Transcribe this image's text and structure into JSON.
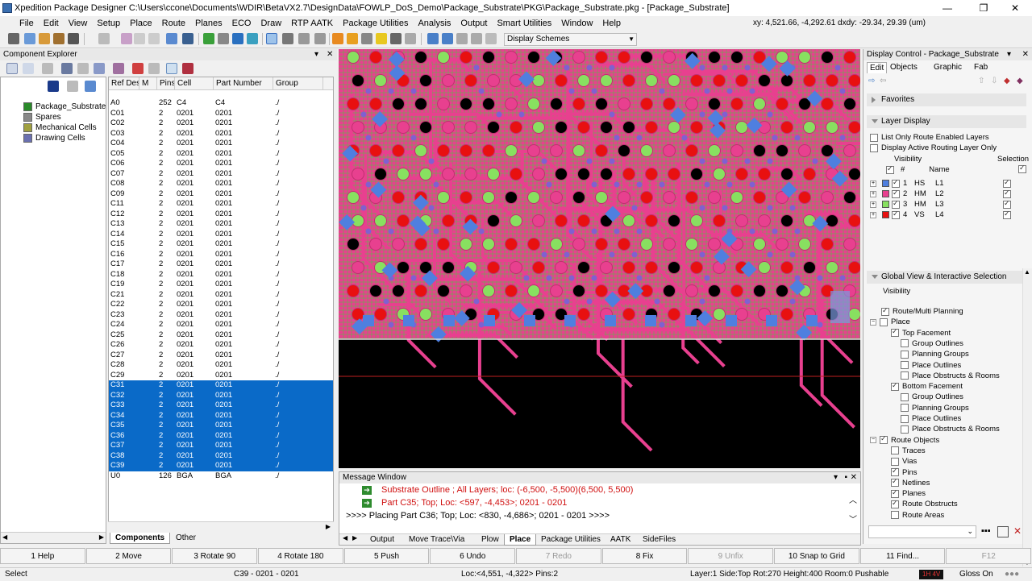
{
  "window": {
    "title": "Xpedition Package Designer  C:\\Users\\ccone\\Documents\\WDIR\\BetaVX2.7\\DesignData\\FOWLP_DoS_Demo\\Package_Substrate\\PKG\\Package_Substrate.pkg - [Package_Substrate]",
    "minimize": "—",
    "restore": "❐",
    "close": "✕"
  },
  "menubar": {
    "items": [
      "File",
      "Edit",
      "View",
      "Setup",
      "Place",
      "Route",
      "Planes",
      "ECO",
      "Draw",
      "RTP AATK",
      "Package Utilities",
      "Analysis",
      "Output",
      "Smart Utilities",
      "Window",
      "Help"
    ],
    "coords": "xy: 4,521.66, -4,292.61  dxdy: -29.34, 29.39 (um)"
  },
  "toolbar": {
    "display_schemes": "Display Schemes"
  },
  "component_explorer": {
    "title": "Component Explorer",
    "tree": [
      "Package_Substrate",
      "Spares",
      "Mechanical Cells",
      "Drawing Cells"
    ],
    "columns": [
      "Ref Des",
      "M",
      "Pins",
      "Cell",
      "Part Number",
      "Group"
    ],
    "rows": [
      {
        "ref": "A0",
        "m": "",
        "pins": "252",
        "cell": "C4",
        "part": "C4",
        "group": "./",
        "sel": false
      },
      {
        "ref": "C01",
        "m": "",
        "pins": "2",
        "cell": "0201",
        "part": "0201",
        "group": "./",
        "sel": false
      },
      {
        "ref": "C02",
        "m": "",
        "pins": "2",
        "cell": "0201",
        "part": "0201",
        "group": "./",
        "sel": false
      },
      {
        "ref": "C03",
        "m": "",
        "pins": "2",
        "cell": "0201",
        "part": "0201",
        "group": "./",
        "sel": false
      },
      {
        "ref": "C04",
        "m": "",
        "pins": "2",
        "cell": "0201",
        "part": "0201",
        "group": "./",
        "sel": false
      },
      {
        "ref": "C05",
        "m": "",
        "pins": "2",
        "cell": "0201",
        "part": "0201",
        "group": "./",
        "sel": false
      },
      {
        "ref": "C06",
        "m": "",
        "pins": "2",
        "cell": "0201",
        "part": "0201",
        "group": "./",
        "sel": false
      },
      {
        "ref": "C07",
        "m": "",
        "pins": "2",
        "cell": "0201",
        "part": "0201",
        "group": "./",
        "sel": false
      },
      {
        "ref": "C08",
        "m": "",
        "pins": "2",
        "cell": "0201",
        "part": "0201",
        "group": "./",
        "sel": false
      },
      {
        "ref": "C09",
        "m": "",
        "pins": "2",
        "cell": "0201",
        "part": "0201",
        "group": "./",
        "sel": false
      },
      {
        "ref": "C11",
        "m": "",
        "pins": "2",
        "cell": "0201",
        "part": "0201",
        "group": "./",
        "sel": false
      },
      {
        "ref": "C12",
        "m": "",
        "pins": "2",
        "cell": "0201",
        "part": "0201",
        "group": "./",
        "sel": false
      },
      {
        "ref": "C13",
        "m": "",
        "pins": "2",
        "cell": "0201",
        "part": "0201",
        "group": "./",
        "sel": false
      },
      {
        "ref": "C14",
        "m": "",
        "pins": "2",
        "cell": "0201",
        "part": "0201",
        "group": "./",
        "sel": false
      },
      {
        "ref": "C15",
        "m": "",
        "pins": "2",
        "cell": "0201",
        "part": "0201",
        "group": "./",
        "sel": false
      },
      {
        "ref": "C16",
        "m": "",
        "pins": "2",
        "cell": "0201",
        "part": "0201",
        "group": "./",
        "sel": false
      },
      {
        "ref": "C17",
        "m": "",
        "pins": "2",
        "cell": "0201",
        "part": "0201",
        "group": "./",
        "sel": false
      },
      {
        "ref": "C18",
        "m": "",
        "pins": "2",
        "cell": "0201",
        "part": "0201",
        "group": "./",
        "sel": false
      },
      {
        "ref": "C19",
        "m": "",
        "pins": "2",
        "cell": "0201",
        "part": "0201",
        "group": "./",
        "sel": false
      },
      {
        "ref": "C21",
        "m": "",
        "pins": "2",
        "cell": "0201",
        "part": "0201",
        "group": "./",
        "sel": false
      },
      {
        "ref": "C22",
        "m": "",
        "pins": "2",
        "cell": "0201",
        "part": "0201",
        "group": "./",
        "sel": false
      },
      {
        "ref": "C23",
        "m": "",
        "pins": "2",
        "cell": "0201",
        "part": "0201",
        "group": "./",
        "sel": false
      },
      {
        "ref": "C24",
        "m": "",
        "pins": "2",
        "cell": "0201",
        "part": "0201",
        "group": "./",
        "sel": false
      },
      {
        "ref": "C25",
        "m": "",
        "pins": "2",
        "cell": "0201",
        "part": "0201",
        "group": "./",
        "sel": false
      },
      {
        "ref": "C26",
        "m": "",
        "pins": "2",
        "cell": "0201",
        "part": "0201",
        "group": "./",
        "sel": false
      },
      {
        "ref": "C27",
        "m": "",
        "pins": "2",
        "cell": "0201",
        "part": "0201",
        "group": "./",
        "sel": false
      },
      {
        "ref": "C28",
        "m": "",
        "pins": "2",
        "cell": "0201",
        "part": "0201",
        "group": "./",
        "sel": false
      },
      {
        "ref": "C29",
        "m": "",
        "pins": "2",
        "cell": "0201",
        "part": "0201",
        "group": "./",
        "sel": false
      },
      {
        "ref": "C31",
        "m": "",
        "pins": "2",
        "cell": "0201",
        "part": "0201",
        "group": "./",
        "sel": true
      },
      {
        "ref": "C32",
        "m": "",
        "pins": "2",
        "cell": "0201",
        "part": "0201",
        "group": "./",
        "sel": true
      },
      {
        "ref": "C33",
        "m": "",
        "pins": "2",
        "cell": "0201",
        "part": "0201",
        "group": "./",
        "sel": true
      },
      {
        "ref": "C34",
        "m": "",
        "pins": "2",
        "cell": "0201",
        "part": "0201",
        "group": "./",
        "sel": true
      },
      {
        "ref": "C35",
        "m": "",
        "pins": "2",
        "cell": "0201",
        "part": "0201",
        "group": "./",
        "sel": true
      },
      {
        "ref": "C36",
        "m": "",
        "pins": "2",
        "cell": "0201",
        "part": "0201",
        "group": "./",
        "sel": true
      },
      {
        "ref": "C37",
        "m": "",
        "pins": "2",
        "cell": "0201",
        "part": "0201",
        "group": "./",
        "sel": true
      },
      {
        "ref": "C38",
        "m": "",
        "pins": "2",
        "cell": "0201",
        "part": "0201",
        "group": "./",
        "sel": true
      },
      {
        "ref": "C39",
        "m": "",
        "pins": "2",
        "cell": "0201",
        "part": "0201",
        "group": "./",
        "sel": true
      },
      {
        "ref": "U0",
        "m": "",
        "pins": "126",
        "cell": "BGA",
        "part": "BGA",
        "group": "./",
        "sel": false
      }
    ],
    "tabs": [
      "Components",
      "Other"
    ]
  },
  "message_window": {
    "title": "Message Window",
    "lines": [
      {
        "text": "Substrate Outline ; All Layers; loc: (-6,500, -5,500)(6,500, 5,500)",
        "color": "red"
      },
      {
        "text": "Part C35; Top; Loc: <597, -4,453>; 0201 - 0201",
        "color": "red"
      },
      {
        "text": ">>>> Placing Part C36; Top; Loc: <830, -4,686>; 0201 - 0201 >>>>",
        "color": "black"
      }
    ],
    "tabs": [
      "Output",
      "Move Trace\\Via",
      "Plow",
      "Place",
      "Package Utilities",
      "AATK",
      "SideFiles"
    ]
  },
  "display_control": {
    "title": "Display Control - Package_Substrate",
    "tabs": [
      "Edit",
      "Objects",
      "Graphic",
      "Fab"
    ],
    "favorites": "Favorites",
    "layer_display": "Layer Display",
    "opt1": "List Only Route Enabled Layers",
    "opt2": "Display Active Routing Layer Only",
    "visibility": "Visibility",
    "selection": "Selection",
    "hash": "#",
    "name_col": "Name",
    "layers": [
      {
        "num": "1",
        "type": "HS",
        "name": "L1",
        "color": "#4f7fdf"
      },
      {
        "num": "2",
        "type": "HM",
        "name": "L2",
        "color": "#e8408f"
      },
      {
        "num": "3",
        "type": "HM",
        "name": "L3",
        "color": "#88e060"
      },
      {
        "num": "4",
        "type": "VS",
        "name": "L4",
        "color": "#e81010"
      }
    ],
    "global_view": "Global View & Interactive Selection",
    "gv_visibility": "Visibility",
    "items": [
      {
        "label": "Route/Multi Planning",
        "indent": 0,
        "checked": true,
        "plus": false
      },
      {
        "label": "Place",
        "indent": 0,
        "checked": false,
        "plus": true
      },
      {
        "label": "Top Facement",
        "indent": 1,
        "checked": true,
        "plus": false
      },
      {
        "label": "Group Outlines",
        "indent": 2,
        "checked": false,
        "plus": false
      },
      {
        "label": "Planning Groups",
        "indent": 2,
        "checked": false,
        "plus": false
      },
      {
        "label": "Place Outlines",
        "indent": 2,
        "checked": false,
        "plus": false
      },
      {
        "label": "Place Obstructs & Rooms",
        "indent": 2,
        "checked": false,
        "plus": false
      },
      {
        "label": "Bottom Facement",
        "indent": 1,
        "checked": true,
        "plus": false
      },
      {
        "label": "Group Outlines",
        "indent": 2,
        "checked": false,
        "plus": false
      },
      {
        "label": "Planning Groups",
        "indent": 2,
        "checked": false,
        "plus": false
      },
      {
        "label": "Place Outlines",
        "indent": 2,
        "checked": false,
        "plus": false
      },
      {
        "label": "Place Obstructs & Rooms",
        "indent": 2,
        "checked": false,
        "plus": false
      },
      {
        "label": "Route Objects",
        "indent": 0,
        "checked": true,
        "plus": true
      },
      {
        "label": "Traces",
        "indent": 1,
        "checked": false,
        "plus": false
      },
      {
        "label": "Vias",
        "indent": 1,
        "checked": false,
        "plus": false
      },
      {
        "label": "Pins",
        "indent": 1,
        "checked": true,
        "plus": false
      },
      {
        "label": "Netlines",
        "indent": 1,
        "checked": true,
        "plus": false
      },
      {
        "label": "Planes",
        "indent": 1,
        "checked": true,
        "plus": false
      },
      {
        "label": "Route Obstructs",
        "indent": 1,
        "checked": true,
        "plus": false
      },
      {
        "label": "Route Areas",
        "indent": 1,
        "checked": false,
        "plus": false
      }
    ]
  },
  "function_keys": [
    {
      "label": "1 Help",
      "enabled": true
    },
    {
      "label": "2 Move",
      "enabled": true
    },
    {
      "label": "3 Rotate 90",
      "enabled": true
    },
    {
      "label": "4 Rotate 180",
      "enabled": true
    },
    {
      "label": "5 Push",
      "enabled": true
    },
    {
      "label": "6 Undo",
      "enabled": true
    },
    {
      "label": "7 Redo",
      "enabled": false
    },
    {
      "label": "8 Fix",
      "enabled": true
    },
    {
      "label": "9 Unfix",
      "enabled": false
    },
    {
      "label": "10 Snap to Grid",
      "enabled": true
    },
    {
      "label": "11 Find...",
      "enabled": true
    },
    {
      "label": "F12",
      "enabled": false
    }
  ],
  "status": {
    "mode": "Select",
    "part": "C39 - 0201 - 0201",
    "loc": "Loc:<4,551, -4,322> Pins:2",
    "layer": "Layer:1 Side:Top Rot:270 Height:400 Room:0  Pushable",
    "indicator": "1H 4V",
    "gloss": "Gloss On"
  },
  "colors": {
    "selection": "#0a6ac8",
    "canvas": "#000000",
    "substrate_pink": "#e8408f",
    "pad_red": "#e81010",
    "pad_green": "#88e060",
    "via_blue": "#4f7fdf"
  }
}
